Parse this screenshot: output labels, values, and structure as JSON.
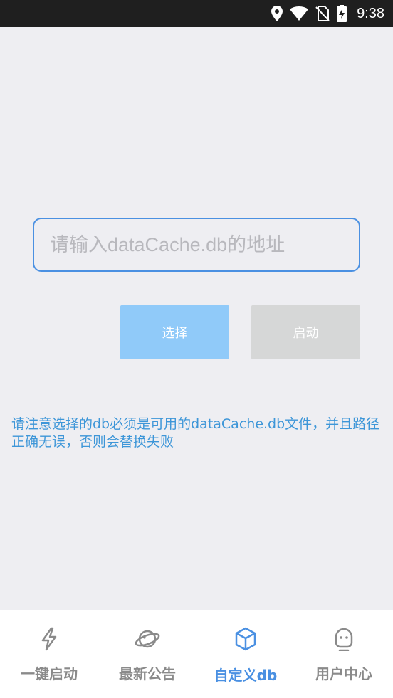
{
  "status_bar": {
    "time": "9:38",
    "icons": [
      "location-icon",
      "wifi-icon",
      "no-sim-icon",
      "battery-charging-icon"
    ]
  },
  "form": {
    "input_placeholder": "请输入dataCache.db的地址",
    "input_value": "",
    "select_button": "选择",
    "start_button": "启动"
  },
  "notice": "请注意选择的db必须是可用的dataCache.db文件，并且路径正确无误，否则会替换失败",
  "tabs": [
    {
      "label": "一键启动",
      "icon": "lightning-icon",
      "active": false
    },
    {
      "label": "最新公告",
      "icon": "planet-icon",
      "active": false
    },
    {
      "label": "自定义db",
      "icon": "cube-icon",
      "active": true
    },
    {
      "label": "用户中心",
      "icon": "user-face-icon",
      "active": false
    }
  ],
  "colors": {
    "accent": "#4a90e2",
    "select_button": "#90caf9",
    "start_button_disabled": "#d6d7d7",
    "notice_text": "#3d96d8",
    "tab_inactive": "#8a8a8a",
    "background": "#eeeef2"
  }
}
